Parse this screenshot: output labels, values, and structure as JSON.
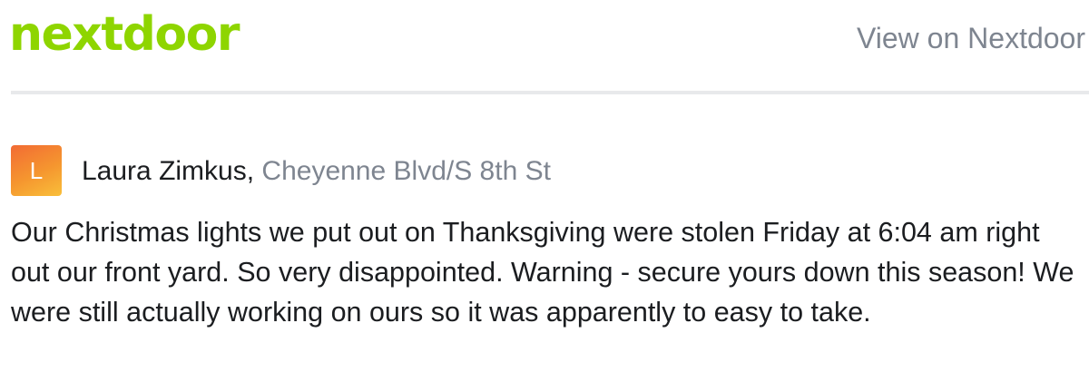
{
  "header": {
    "logo_text": "nextdoor",
    "view_link_label": "View on Nextdoor"
  },
  "colors": {
    "brand_green": "#8ed500",
    "secondary_text": "#7e8590",
    "primary_text": "#1b1d20",
    "avatar_orange": "#f5962f"
  },
  "post": {
    "avatar_initial": "L",
    "author_name": "Laura Zimkus",
    "separator": ", ",
    "location": "Cheyenne Blvd/S 8th St",
    "body": "Our Christmas lights we put out on Thanksgiving were stolen Friday at 6:04 am right out our front yard. So very disappointed. Warning - secure yours down this season! We were still actually working on ours so it was apparently to easy to take."
  }
}
